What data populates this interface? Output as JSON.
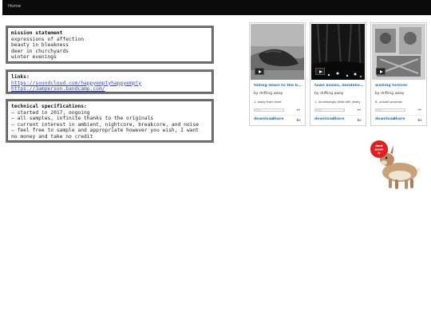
{
  "nav": {
    "home": "Home"
  },
  "mission": {
    "heading": "mission statement",
    "lines": [
      "expressions of affection",
      "beauty in bleakness",
      "deer in churchyards",
      "winter evenings"
    ]
  },
  "links": {
    "heading": "links:",
    "items": [
      "https://soundcloud.com/happyemptyhappyempty",
      "https://3amperson.bandcamp.com/"
    ]
  },
  "specs": {
    "heading": "technical specifications:",
    "lines": [
      "— started in 2017, ongoing",
      "— all samples, infinite thanks to the originals",
      "— current interest in ambient, nightcore, breakcore, and noise",
      "— feel free to sample and appropriate however you wish, I want",
      "no money and take no credit"
    ]
  },
  "players": [
    {
      "title": "falling down to the bottom",
      "artist": "by drifting away",
      "track": "1.  away from here",
      "download": "download",
      "share": "share",
      "logo": "bc",
      "progress": 0.0
    },
    {
      "title": "fawn kisses, dandelion seeds",
      "artist": "by drifting away",
      "track": "1.  increasingly little left, lately",
      "download": "download",
      "share": "share",
      "logo": "bc",
      "progress": 0.0
    },
    {
      "title": "waiting forever",
      "artist": "by drifting away",
      "track": "6.  unsaid promise",
      "download": "download",
      "share": "share",
      "logo": "bc",
      "progress": 0.0
    }
  ],
  "sticker": {
    "lines": [
      "dont",
      "panic",
      "ly"
    ],
    "badge_color": "#e02020"
  }
}
